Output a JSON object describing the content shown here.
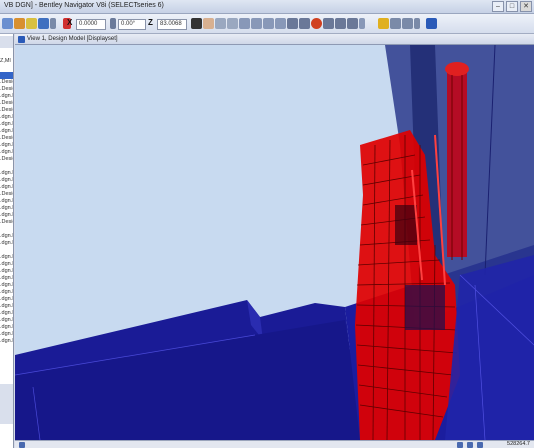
{
  "window": {
    "title": "VB DGN] - Bentley Navigator V8i (SELECTseries 6)",
    "minimize": "–",
    "maximize": "□",
    "close": "✕"
  },
  "toolbar": {
    "x_label": "X",
    "x_value": "0.0000",
    "y_label": "Y",
    "y_value": "0.00°",
    "z_label": "Z",
    "z_value": "83.0068"
  },
  "tree": {
    "rows": [
      "",
      "",
      "",
      "",
      "",
      "",
      "Z,Ml",
      "",
      "",
      ".Desig",
      ".Desig",
      ".dgn.D",
      ".Desig",
      ".Desig",
      ".dgn.D",
      ".dgn.D",
      ".dgn.D",
      ".Desig",
      ".dgn.D",
      ".dgn.D",
      ".Desig",
      "",
      ".dgn.D",
      ".dgn.D",
      ".dgn.D",
      ".Desig",
      ".dgn.D",
      ".dgn.D",
      ".dgn.D",
      ".Desig",
      "",
      "",
      ".dgn.D",
      ".dgn.D",
      ".dgn.D",
      ".dgn.D",
      ".dgn.D",
      ".dgn.D",
      ".dgn.D",
      ".dgn.D",
      ".dgn.D",
      ".dgn.D",
      ".dgn.D",
      ".dgn.D",
      ".dgn.D",
      ".dgn.D",
      ".dgn.D"
    ]
  },
  "view": {
    "title": "View 1, Design Model [Displayset]"
  },
  "status": {
    "coords": "528264.7"
  },
  "colors": {
    "sky": "#c8daf0",
    "floor": "#1a1b96",
    "model_red": "#e00000",
    "glass": "#2b3a8c"
  }
}
